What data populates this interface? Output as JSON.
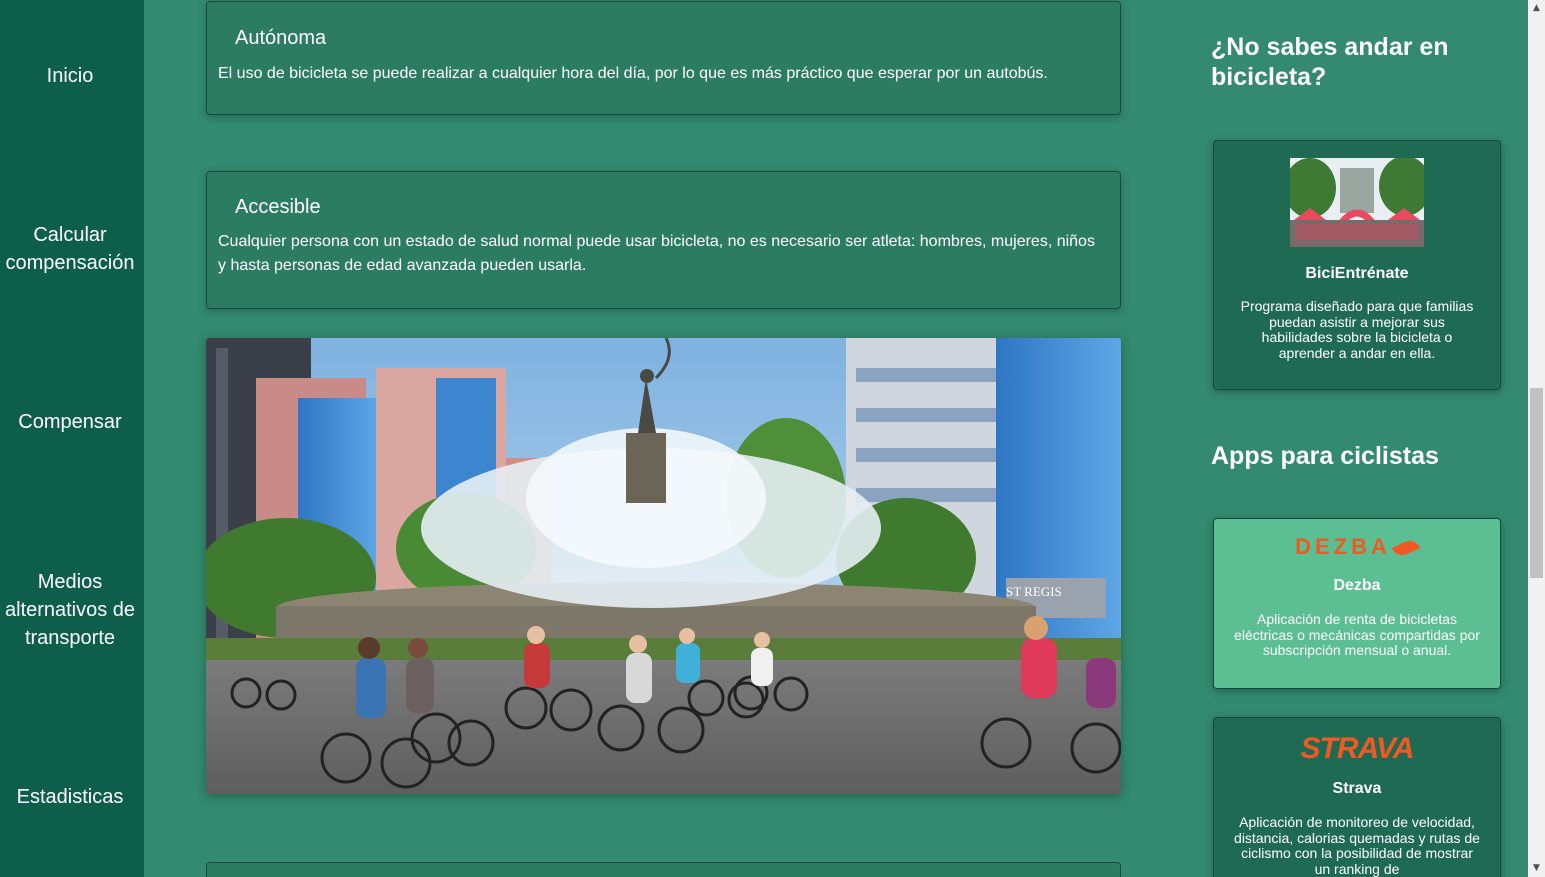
{
  "sidebar": {
    "items": [
      {
        "label": "Inicio"
      },
      {
        "label": "Calcular compensación"
      },
      {
        "label": "Compensar"
      },
      {
        "label": "Medios alternativos de transporte"
      },
      {
        "label": "Estadisticas"
      }
    ]
  },
  "main": {
    "cards": [
      {
        "title": "Autónoma",
        "text": "El uso de bicicleta se puede realizar a cualquier hora del día, por lo que es más práctico que esperar por un autobús."
      },
      {
        "title": "Accesible",
        "text": "Cualquier persona con un estado de salud normal puede usar bicicleta, no es necesario ser atleta: hombres, mujeres, niños y hasta personas de edad avanzada pueden usarla."
      }
    ],
    "photo_sign": "ST REGIS"
  },
  "aside": {
    "learn_heading": "¿No sabes andar en bicicleta?",
    "program": {
      "title": "BiciEntrénate",
      "text": "Programa diseñado para que familias puedan asistir a mejorar sus habilidades sobre la bicicleta o aprender a andar en ella."
    },
    "apps_heading": "Apps para ciclistas",
    "apps": [
      {
        "logo": "DEZBA",
        "title": "Dezba",
        "text": "Aplicación de renta de bicicletas eléctricas o mecánicas compartidas por subscripción mensual o anual."
      },
      {
        "logo": "STRAVA",
        "title": "Strava",
        "text": "Aplicación de monitoreo de velocidad, distancia, calorias quemadas y rutas de ciclismo con la posibilidad de mostrar un ranking de"
      }
    ]
  },
  "colors": {
    "background": "#338a6e",
    "sidebar": "#0d5e4a",
    "card": "#2c7c62",
    "highlight_card": "#5bbf93",
    "brand_orange": "#f05a22"
  }
}
